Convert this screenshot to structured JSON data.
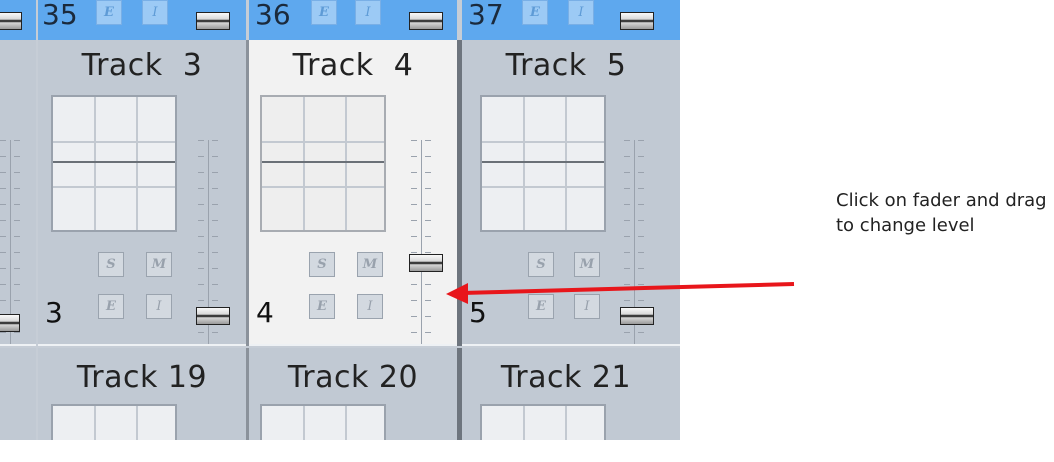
{
  "strips": {
    "top": [
      {
        "number": "35",
        "edit_label": "E",
        "insert_label": "I"
      },
      {
        "number": "36",
        "edit_label": "E",
        "insert_label": "I"
      },
      {
        "number": "37",
        "edit_label": "E",
        "insert_label": "I"
      }
    ],
    "middle": [
      {
        "name": "Track  3",
        "number": "3",
        "solo_label": "S",
        "mute_label": "M",
        "edit_label": "E",
        "insert_label": "I",
        "fader_level": 0.05
      },
      {
        "name": "Track  4",
        "number": "4",
        "solo_label": "S",
        "mute_label": "M",
        "edit_label": "E",
        "insert_label": "I",
        "fader_level": 0.35,
        "selected": true
      },
      {
        "name": "Track  5",
        "number": "5",
        "solo_label": "S",
        "mute_label": "M",
        "edit_label": "E",
        "insert_label": "I",
        "fader_level": 0.05
      }
    ],
    "bottom": [
      {
        "name": "Track 19"
      },
      {
        "name": "Track 20"
      },
      {
        "name": "Track 21"
      }
    ]
  },
  "annotation": {
    "text": "Click on fader and drag it to change level",
    "arrow_color": "#e8161b"
  },
  "colors": {
    "strip_bg": "#c1c9d3",
    "selected_strip_bg": "#f2f2f2",
    "top_row_bg": "#5ea8ee"
  }
}
